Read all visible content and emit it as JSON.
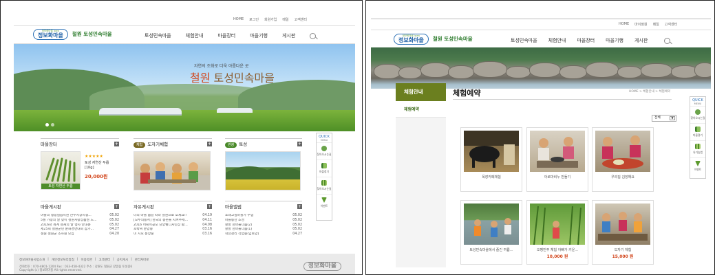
{
  "left": {
    "utility_links": [
      "HOME",
      "로그인",
      "회원가입",
      "메일",
      "고객센터"
    ],
    "logo": {
      "small": "정보화마을 ipaw",
      "main": "정보화마을",
      "site_name": "철원 토성민속마을"
    },
    "nav": [
      "토성민속마을",
      "체험안내",
      "마을장터",
      "마을기행",
      "게시판"
    ],
    "hero": {
      "subtitle": "자연의 조화로 더욱 아름다운 곳",
      "title_a": "철원",
      "title_b": "토성민속마을"
    },
    "market": {
      "title": "마을장터",
      "product_name": "토성 자연산 두릅",
      "product_unit": "[1Kg]",
      "price": "20,000원",
      "stars": "★★★★★",
      "photo_label": "토성 자연산 두릅"
    },
    "experience": {
      "tag": "체험",
      "title": "도자기체험"
    },
    "tour": {
      "tag": "관광",
      "title": "토성"
    },
    "board1": {
      "title": "마을게시판",
      "rows": [
        {
          "t": "마을의 행정실습지원 한수시장지정...",
          "d": "05.02"
        },
        {
          "t": "5월 가정의 달 맞이 철원사랑상품권 드...",
          "d": "05.02"
        },
        {
          "t": "2016년 세계 철새의 날 행사 안내문",
          "d": "05.02"
        },
        {
          "t": "제25회 철원군민 문화경연대회 참가...",
          "d": "04.27"
        },
        {
          "t": "철원 철원군 조사원 모집",
          "d": "04.20"
        }
      ]
    },
    "board2": {
      "title": "자유게시판",
      "rows": [
        {
          "t": "나의 마을 봄길 따라 철원으로 오세요!!",
          "d": "04.19"
        },
        {
          "t": "[모두의동서] 한국의 농촌을 지켜주세...",
          "d": "04.11"
        },
        {
          "t": "2016 어린이공모 단양벨디자인상 활...",
          "d": "04.08"
        },
        {
          "t": "호박씨 분양중",
          "d": "03.16"
        },
        {
          "t": "미 치오 분양중",
          "d": "03.16"
        }
      ]
    },
    "board3": {
      "title": "마을앨범",
      "rows": [
        {
          "t": "소래고실마을가 수업",
          "d": "05.02"
        },
        {
          "t": "마을동산 조성",
          "d": "05.02"
        },
        {
          "t": "잘할 한마을다움(2)",
          "d": "05.02"
        },
        {
          "t": "잘할 한마을다움(1)",
          "d": "05.02"
        },
        {
          "t": "학산찰리 작업중(임토양)",
          "d": "04.27"
        }
      ]
    },
    "quick": {
      "title": "QUICK",
      "subtitle": "MENU",
      "items": [
        "찾아오시는길",
        "마을정기",
        "찾아오시는길",
        "이벤트"
      ]
    },
    "footer": {
      "links": [
        "정보화마을사업소개",
        "개인정보처리방침",
        "이용약관",
        "고객센터",
        "공지게시",
        "관리자바로"
      ],
      "info1": "전화번호 : 070-4801-1204  Fax : 033-458-4322  주소 : 강원도 철원군 갈말읍 토성길6",
      "info2": "Copyright (c) 정보화마을 All rights reserved.",
      "logo": "정보화마을"
    }
  },
  "right": {
    "utility_links": [
      "HOME",
      "마이정원",
      "메일",
      "고객센터"
    ],
    "logo": {
      "small": "정보화마을 ipaw",
      "main": "정보화마을",
      "site_name": "철원 토성민속마을"
    },
    "nav": [
      "토성민속마을",
      "체험안내",
      "마을장터",
      "마을기행",
      "게시판"
    ],
    "sidebar": {
      "title": "체험안내",
      "items": [
        "체험예약"
      ]
    },
    "page_title": "체험예약",
    "breadcrumb": "HOME > 체험안내 > 체험예약",
    "filter_value": "전체",
    "cards": [
      {
        "caption": "목장카페체험",
        "price": ""
      },
      {
        "caption": "아로마비누 만들기",
        "price": ""
      },
      {
        "caption": "우리집 김장해요",
        "price": ""
      },
      {
        "caption": "토성민속마을에서 즐긴 여름...",
        "price": ""
      },
      {
        "caption": "오팽민주 체험 아빠가 키운...",
        "price": "10,000 원"
      },
      {
        "caption": "도자기 체험",
        "price": "15,000 원"
      }
    ],
    "quick": {
      "title": "QUICK",
      "subtitle": "MENU",
      "items": [
        "찾아오시는길",
        "마을정기",
        "유기농법",
        "이벤트"
      ]
    }
  },
  "colors": {
    "brand_blue": "#1d5fa6",
    "brand_green": "#2f7d2f",
    "sidebar_olive": "#6b7f1f",
    "price_red": "#d2451b"
  }
}
